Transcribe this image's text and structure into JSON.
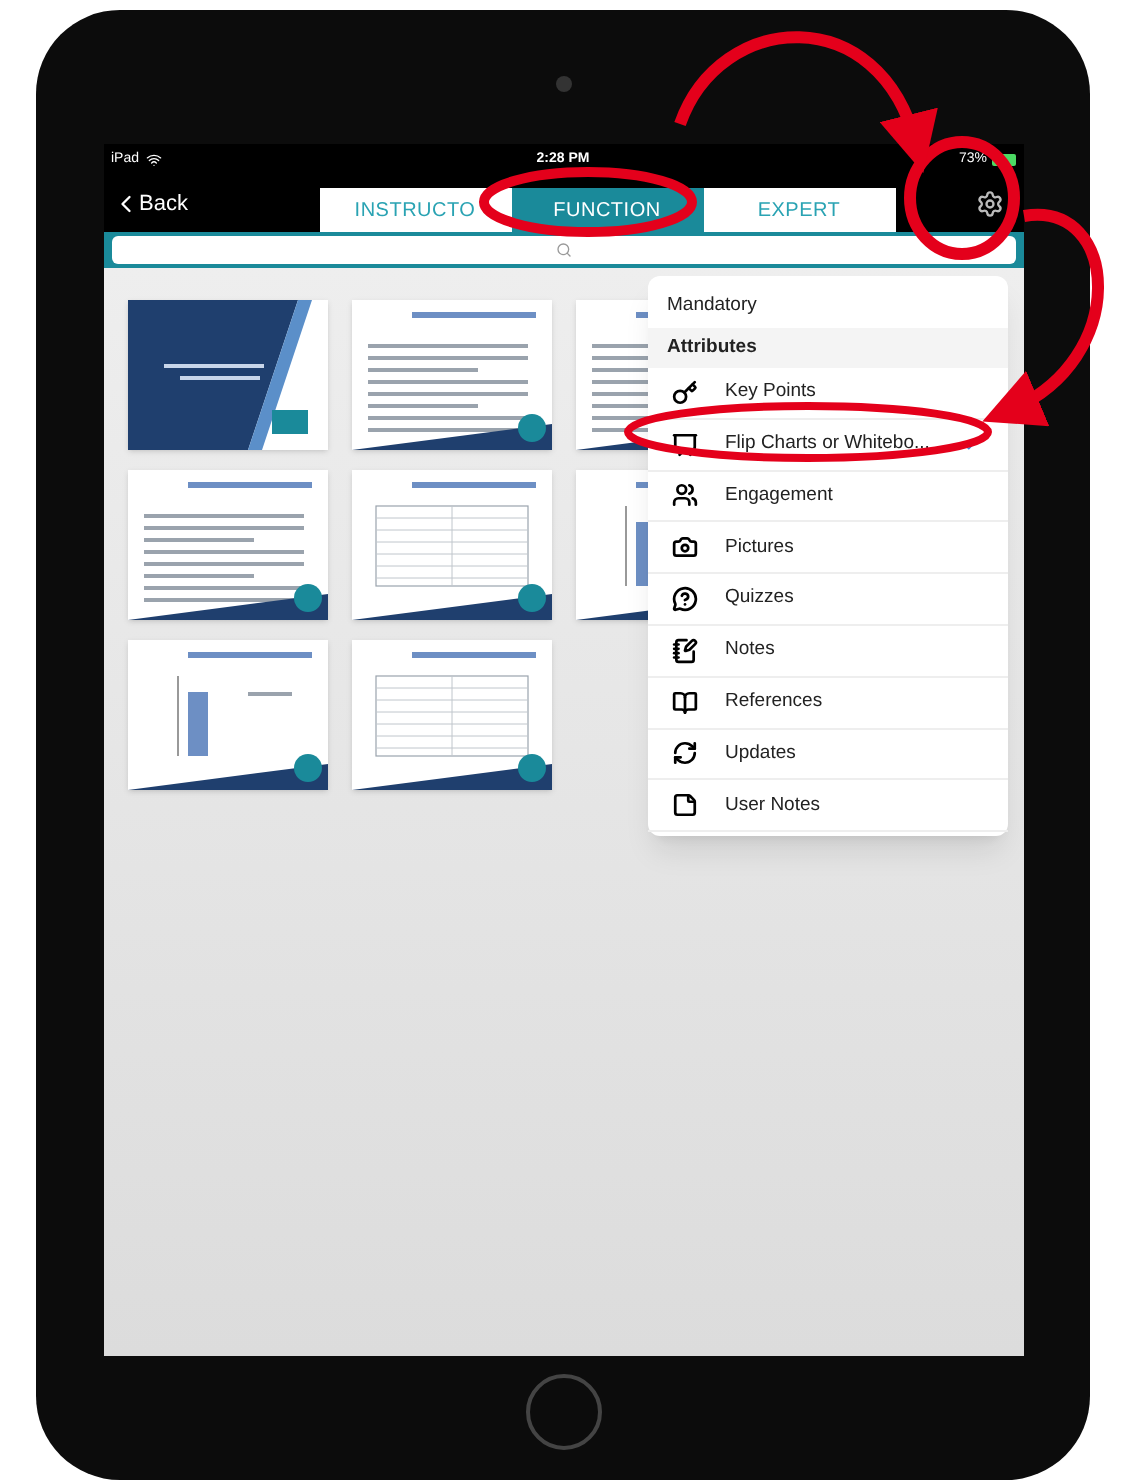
{
  "status_bar": {
    "device": "iPad",
    "time": "2:28 PM",
    "battery": "73%"
  },
  "nav": {
    "back": "Back",
    "tabs": [
      {
        "label": "INSTRUCTO",
        "selected": false
      },
      {
        "label": "FUNCTION",
        "selected": true
      },
      {
        "label": "EXPERT",
        "selected": false
      }
    ]
  },
  "slides": [
    {
      "kind": "title"
    },
    {
      "kind": "bullets"
    },
    {
      "kind": "bullets"
    },
    {
      "kind": "bullets"
    },
    {
      "kind": "table"
    },
    {
      "kind": "chart"
    },
    {
      "kind": "chart"
    },
    {
      "kind": "table"
    }
  ],
  "menu": {
    "mandatory": "Mandatory",
    "section": "Attributes",
    "items": [
      {
        "label": "Key Points",
        "selected": false
      },
      {
        "label": "Flip Charts or Whitebo...",
        "selected": true
      },
      {
        "label": "Engagement",
        "selected": false
      },
      {
        "label": "Pictures",
        "selected": false
      },
      {
        "label": "Quizzes",
        "selected": false
      },
      {
        "label": "Notes",
        "selected": false
      },
      {
        "label": "References",
        "selected": false
      },
      {
        "label": "Updates",
        "selected": false
      },
      {
        "label": "User Notes",
        "selected": false
      }
    ]
  }
}
